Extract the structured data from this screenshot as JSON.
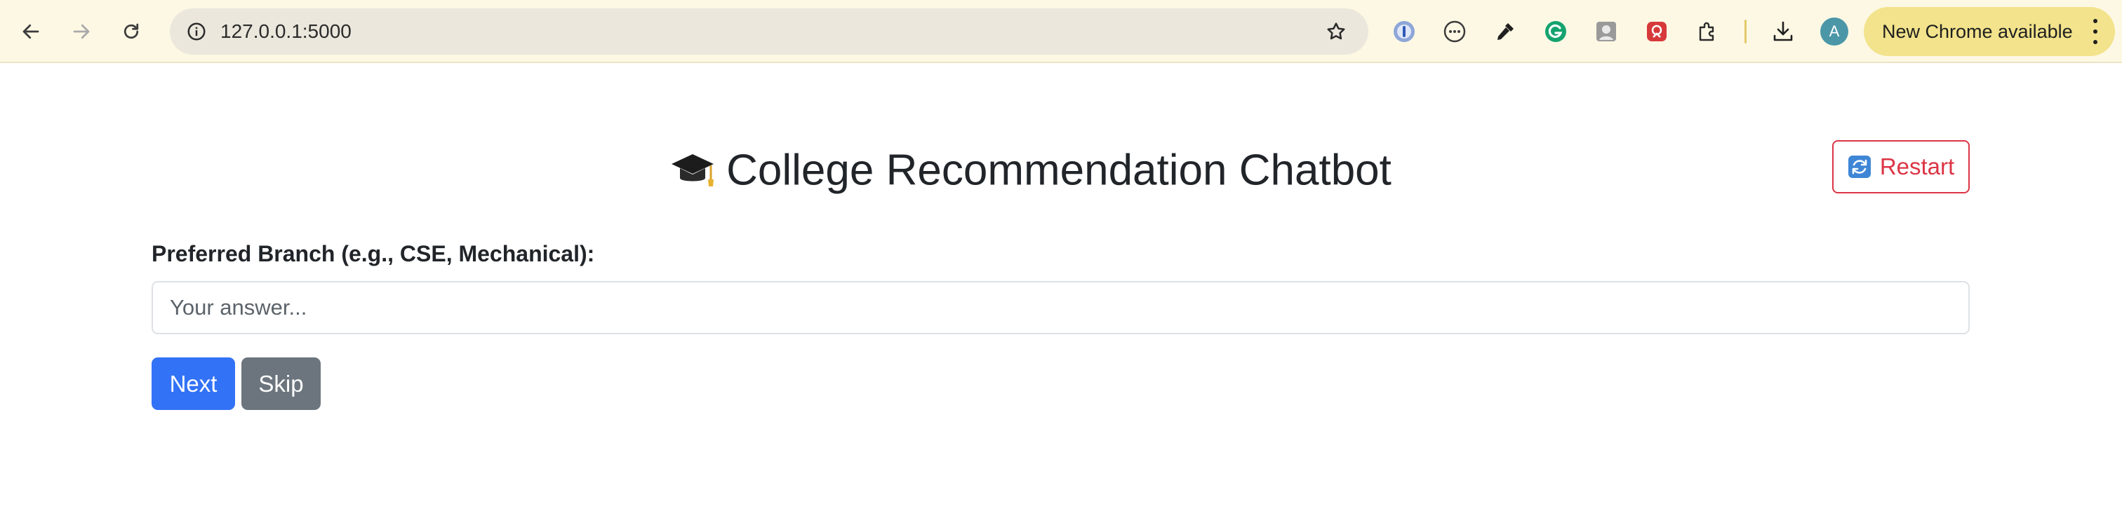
{
  "browser": {
    "url": "127.0.0.1:5000",
    "profile_initial": "A",
    "update_label": "New Chrome available",
    "extensions": [
      {
        "name": "1password-icon"
      },
      {
        "name": "dots-circle-icon"
      },
      {
        "name": "eyedropper-icon"
      },
      {
        "name": "grammarly-icon"
      },
      {
        "name": "portrait-icon"
      },
      {
        "name": "shield-extension-icon"
      },
      {
        "name": "puzzle-extensions-icon"
      }
    ]
  },
  "page": {
    "title": "College Recommendation Chatbot",
    "restart_label": "Restart",
    "question_label": "Preferred Branch (e.g., CSE, Mechanical):",
    "answer_value": "",
    "answer_placeholder": "Your answer...",
    "next_label": "Next",
    "skip_label": "Skip"
  },
  "colors": {
    "primary": "#3272f6",
    "secondary": "#6c757d",
    "danger": "#dc3545",
    "toolbar_bg": "#fdf8e4",
    "update_chip": "#f2e38c"
  }
}
